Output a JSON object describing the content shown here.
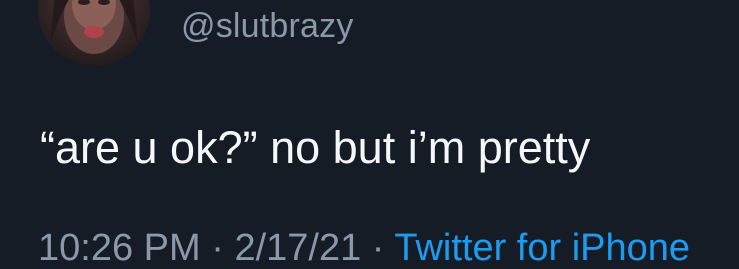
{
  "tweet": {
    "author": {
      "handle": "@slutbrazy",
      "avatar_icon": "profile-photo"
    },
    "text": "“are u ok?” no but i’m pretty",
    "meta": {
      "time": "10:26 PM",
      "separator1": " · ",
      "date": "2/17/21",
      "separator2": " · ",
      "source": "Twitter for iPhone"
    }
  },
  "colors": {
    "background": "#151c26",
    "text": "#f5f8fa",
    "secondary_text": "#8a98a7",
    "link": "#1d9bf0"
  }
}
